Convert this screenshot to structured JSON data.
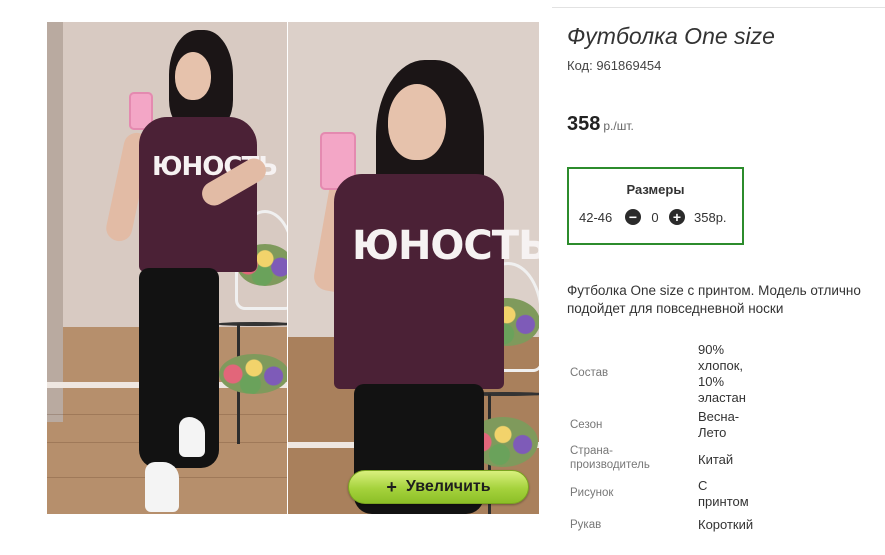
{
  "gallery": {
    "shirt_print_1": "ЮНОСТЬ",
    "shirt_print_2": "ЮНОСТЬ",
    "zoom_button_label": "Увеличить",
    "zoom_icon": "plus-icon"
  },
  "product": {
    "title": "Футболка One size",
    "code": "Код: 961869454",
    "price": "358",
    "price_unit": "р./шт."
  },
  "sizes": {
    "title": "Размеры",
    "rows": [
      {
        "size": "42-46",
        "qty": "0",
        "price": "358р."
      }
    ],
    "border_color": "#2c8c2c"
  },
  "description": {
    "line1": "Футболка One size с принтом. Модель отлично",
    "line2": "подойдет для повседневной носки"
  },
  "specs": [
    {
      "label": "Состав",
      "value": "90% хлопок, 10% эластан"
    },
    {
      "label": "Сезон",
      "value": "Весна-Лето"
    },
    {
      "label": "Страна-производитель",
      "value": "Китай"
    },
    {
      "label": "Рисунок",
      "value": "С принтом"
    },
    {
      "label": "Рукав",
      "value": "Короткий"
    }
  ],
  "colors": {
    "shirt": "#4b2136",
    "zoom_button": "#a5d23c"
  }
}
